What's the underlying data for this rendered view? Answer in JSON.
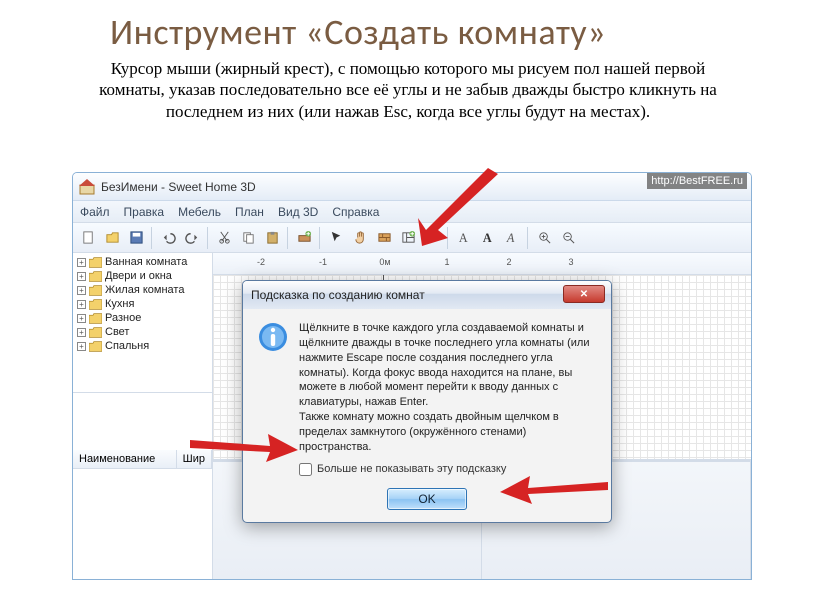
{
  "slide": {
    "title": "Инструмент «Создать комнату»",
    "description": "Курсор мыши (жирный крест), с помощью которого мы рисуем пол нашей первой комнаты, указав последовательно все её углы и не забыв дважды быстро кликнуть на последнем из них (или нажав Esc, когда все углы будут на местах)."
  },
  "app": {
    "title": "БезИмени - Sweet Home 3D",
    "watermark": "http://BestFREE.ru",
    "menu": [
      "Файл",
      "Правка",
      "Мебель",
      "План",
      "Вид 3D",
      "Справка"
    ],
    "ruler_labels": [
      "-2",
      "-1",
      "0м",
      "1",
      "2",
      "3"
    ],
    "tree": [
      "Ванная комната",
      "Двери и окна",
      "Жилая комната",
      "Кухня",
      "Разное",
      "Свет",
      "Спальня"
    ],
    "table_headers": [
      "Наименование",
      "Шир"
    ]
  },
  "dialog": {
    "title": "Подсказка по созданию комнат",
    "body": "Щёлкните в точке каждого угла создаваемой комнаты и щёлкните дважды в точке последнего угла комнаты (или нажмите Escape после создания последнего угла комнаты). Когда фокус ввода находится на плане, вы можете в любой момент перейти к вводу данных с клавиатуры, нажав Enter.\nТакже комнату можно создать двойным щелчком в пределах замкнутого (окружённого стенами) пространства.",
    "checkbox_label": "Больше не показывать эту подсказку",
    "ok_label": "OK"
  }
}
